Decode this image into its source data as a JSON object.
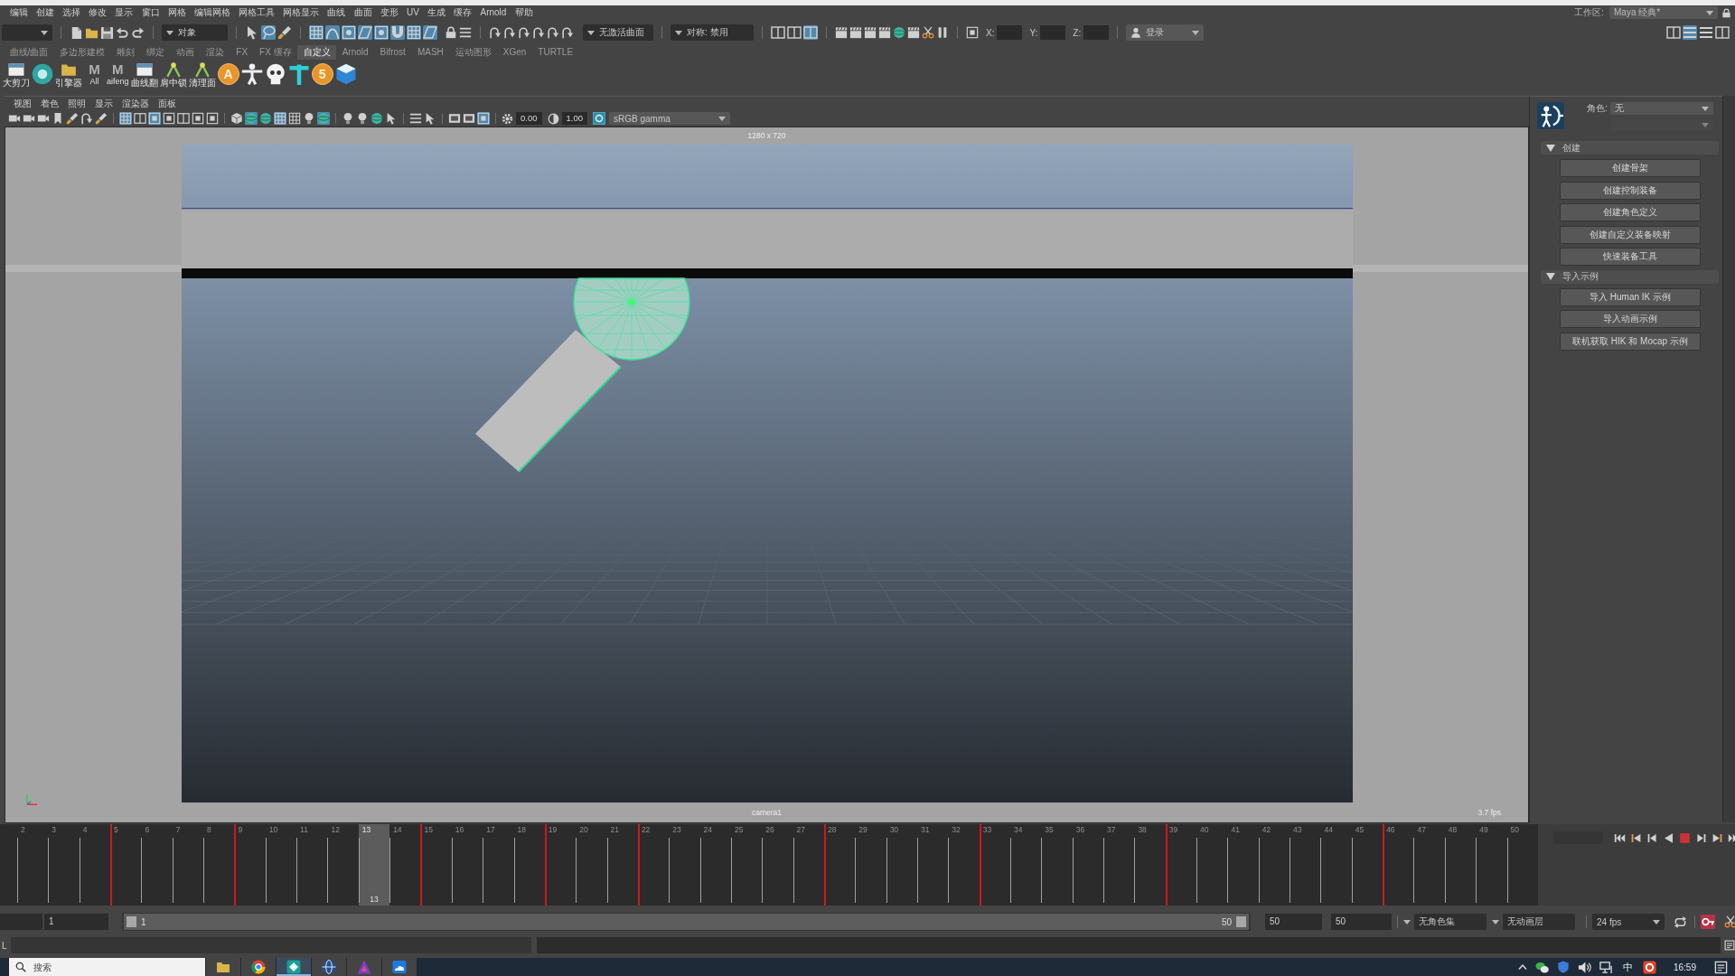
{
  "menu_bar": {
    "items": [
      "编辑",
      "创建",
      "选择",
      "修改",
      "显示",
      "窗口",
      "网格",
      "编辑网格",
      "网格工具",
      "网格显示",
      "曲线",
      "曲面",
      "变形",
      "UV",
      "生成",
      "缓存",
      "Arnold",
      "帮助"
    ],
    "workspace_label": "工作区:",
    "workspace": "Maya 经典*"
  },
  "status_line": {
    "selection_mode": "对象",
    "select_tools": [
      {
        "on": false
      },
      {
        "on": true
      },
      {
        "on": false
      }
    ],
    "snap_toggles": [
      {
        "on": true
      },
      {
        "on": true
      },
      {
        "on": true
      },
      {
        "on": true
      },
      {
        "on": true
      },
      {
        "on": true
      },
      {
        "on": true
      },
      {
        "on": true
      }
    ],
    "live_surface": "无激活曲面",
    "symmetry": "对称: 禁用",
    "panel_toggles": [
      {
        "on": false
      },
      {
        "on": false
      },
      {
        "on": true
      }
    ],
    "coordinates": [
      {
        "axis": "X:"
      },
      {
        "axis": "Y:"
      },
      {
        "axis": "Z:"
      }
    ],
    "login": "登录",
    "layout_toggles": [
      {
        "on": false
      },
      {
        "on": true
      },
      {
        "on": false
      },
      {
        "on": false
      }
    ]
  },
  "shelf": {
    "tabs": [
      {
        "label": "曲线/曲面",
        "selected": false
      },
      {
        "label": "多边形建模",
        "selected": false
      },
      {
        "label": "雕刻",
        "selected": false
      },
      {
        "label": "绑定",
        "selected": false
      },
      {
        "label": "动画",
        "selected": false
      },
      {
        "label": "渲染",
        "selected": false
      },
      {
        "label": "FX",
        "selected": false
      },
      {
        "label": "FX 缓存",
        "selected": false
      },
      {
        "label": "自定义",
        "selected": true
      },
      {
        "label": "Arnold",
        "selected": false
      },
      {
        "label": "Bifrost",
        "selected": false
      },
      {
        "label": "MASH",
        "selected": false
      },
      {
        "label": "运动图形",
        "selected": false
      },
      {
        "label": "XGen",
        "selected": false
      },
      {
        "label": "TURTLE",
        "selected": false
      }
    ],
    "tools": [
      {
        "kind": "tile",
        "label": "大剪刀"
      },
      {
        "kind": "ring"
      },
      {
        "kind": "folder",
        "label": "引擎器"
      },
      {
        "kind": "letter",
        "glyph": "M",
        "label": "All"
      },
      {
        "kind": "letter",
        "glyph": "M",
        "label": "aifeng"
      },
      {
        "kind": "tile",
        "label": "曲线翻"
      },
      {
        "kind": "joint",
        "label": "肩中锁"
      },
      {
        "kind": "joint",
        "label": "清理面"
      },
      {
        "kind": "coin",
        "glyph": "A"
      },
      {
        "kind": "figure"
      },
      {
        "kind": "skull"
      },
      {
        "kind": "cross"
      },
      {
        "kind": "coin",
        "glyph": "5"
      },
      {
        "kind": "cube"
      }
    ]
  },
  "viewport": {
    "menu": [
      "视图",
      "着色",
      "照明",
      "显示",
      "渲染器",
      "面板"
    ],
    "toolbar_groups": [
      [
        {
          "on": false
        },
        {
          "on": false
        },
        {
          "on": false
        },
        {
          "on": false
        },
        {
          "on": false
        },
        {
          "on": false
        },
        {
          "on": false
        }
      ],
      [
        {
          "on": true
        },
        {
          "on": false
        },
        {
          "on": true
        },
        {
          "on": false
        },
        {
          "on": false
        },
        {
          "on": false
        },
        {
          "on": false
        }
      ],
      [
        {
          "on": false
        },
        {
          "on": true
        },
        {
          "on": false
        },
        {
          "on": true
        },
        {
          "on": false
        },
        {
          "on": false
        },
        {
          "on": true
        }
      ],
      [
        {
          "on": false
        },
        {
          "on": false
        },
        {
          "on": false
        },
        {
          "on": false
        }
      ],
      [
        {
          "on": false
        },
        {
          "on": false
        }
      ],
      [
        {
          "on": false
        },
        {
          "on": false
        },
        {
          "on": true
        }
      ]
    ],
    "exposure": "0.00",
    "gamma": "1.00",
    "color_management": true,
    "color_space": "sRGB gamma",
    "resolution": "1280 x 720",
    "camera": "camera1",
    "fps": "3.7 fps"
  },
  "human_ik": {
    "character_label": "角色:",
    "character": "无",
    "source_disabled": true,
    "sections": [
      {
        "title": "创建",
        "expanded": true,
        "buttons": [
          "创建骨架",
          "创建控制装备",
          "创建角色定义",
          "创建自定义装备映射",
          "快速装备工具"
        ]
      },
      {
        "title": "导入示例",
        "expanded": true,
        "buttons": [
          "导入 Human IK 示例",
          "导入动画示例",
          "联机获取 HIK 和 Mocap 示例"
        ]
      }
    ]
  },
  "time_slider": {
    "frames": [
      {
        "label": "2",
        "key": false,
        "selected": false
      },
      {
        "label": "3",
        "key": false,
        "selected": false
      },
      {
        "label": "4",
        "key": false,
        "selected": false
      },
      {
        "label": "5",
        "key": true,
        "selected": false
      },
      {
        "label": "6",
        "key": false,
        "selected": false
      },
      {
        "label": "7",
        "key": false,
        "selected": false
      },
      {
        "label": "8",
        "key": false,
        "selected": false
      },
      {
        "label": "9",
        "key": true,
        "selected": false
      },
      {
        "label": "10",
        "key": false,
        "selected": false
      },
      {
        "label": "11",
        "key": false,
        "selected": false
      },
      {
        "label": "12",
        "key": false,
        "selected": false
      },
      {
        "label": "13",
        "key": false,
        "selected": true
      },
      {
        "label": "14",
        "key": false,
        "selected": false
      },
      {
        "label": "15",
        "key": true,
        "selected": false
      },
      {
        "label": "16",
        "key": false,
        "selected": false
      },
      {
        "label": "17",
        "key": false,
        "selected": false
      },
      {
        "label": "18",
        "key": false,
        "selected": false
      },
      {
        "label": "19",
        "key": true,
        "selected": false
      },
      {
        "label": "20",
        "key": false,
        "selected": false
      },
      {
        "label": "21",
        "key": false,
        "selected": false
      },
      {
        "label": "22",
        "key": true,
        "selected": false
      },
      {
        "label": "23",
        "key": false,
        "selected": false
      },
      {
        "label": "24",
        "key": false,
        "selected": false
      },
      {
        "label": "25",
        "key": false,
        "selected": false
      },
      {
        "label": "26",
        "key": false,
        "selected": false
      },
      {
        "label": "27",
        "key": false,
        "selected": false
      },
      {
        "label": "28",
        "key": true,
        "selected": false
      },
      {
        "label": "29",
        "key": false,
        "selected": false
      },
      {
        "label": "30",
        "key": false,
        "selected": false
      },
      {
        "label": "31",
        "key": false,
        "selected": false
      },
      {
        "label": "32",
        "key": false,
        "selected": false
      },
      {
        "label": "33",
        "key": true,
        "selected": false
      },
      {
        "label": "34",
        "key": false,
        "selected": false
      },
      {
        "label": "35",
        "key": false,
        "selected": false
      },
      {
        "label": "36",
        "key": false,
        "selected": false
      },
      {
        "label": "37",
        "key": false,
        "selected": false
      },
      {
        "label": "38",
        "key": false,
        "selected": false
      },
      {
        "label": "39",
        "key": true,
        "selected": false
      },
      {
        "label": "40",
        "key": false,
        "selected": false
      },
      {
        "label": "41",
        "key": false,
        "selected": false
      },
      {
        "label": "42",
        "key": false,
        "selected": false
      },
      {
        "label": "43",
        "key": false,
        "selected": false
      },
      {
        "label": "44",
        "key": false,
        "selected": false
      },
      {
        "label": "45",
        "key": false,
        "selected": false
      },
      {
        "label": "46",
        "key": true,
        "selected": false
      },
      {
        "label": "47",
        "key": false,
        "selected": false
      },
      {
        "label": "48",
        "key": false,
        "selected": false
      },
      {
        "label": "49",
        "key": false,
        "selected": false
      },
      {
        "label": "50",
        "key": false,
        "selected": false
      }
    ],
    "current_frame": "13",
    "playing": true
  },
  "range_slider": {
    "playback_start": "1",
    "level": 1,
    "bar_start": "1",
    "bar_end": "50",
    "playback_end": "50",
    "animation_end": "50",
    "character_set": "无角色集",
    "anim_layer": "无动画层",
    "fps": "24 fps",
    "auto_key": true
  },
  "command_line": {
    "language": "L"
  },
  "taskbar": {
    "search_placeholder": "搜索",
    "apps": [
      {
        "selected": false
      },
      {
        "selected": false
      },
      {
        "selected": true
      },
      {
        "selected": false
      },
      {
        "selected": false
      },
      {
        "selected": false
      }
    ],
    "ime": "中",
    "time": "16:59"
  }
}
